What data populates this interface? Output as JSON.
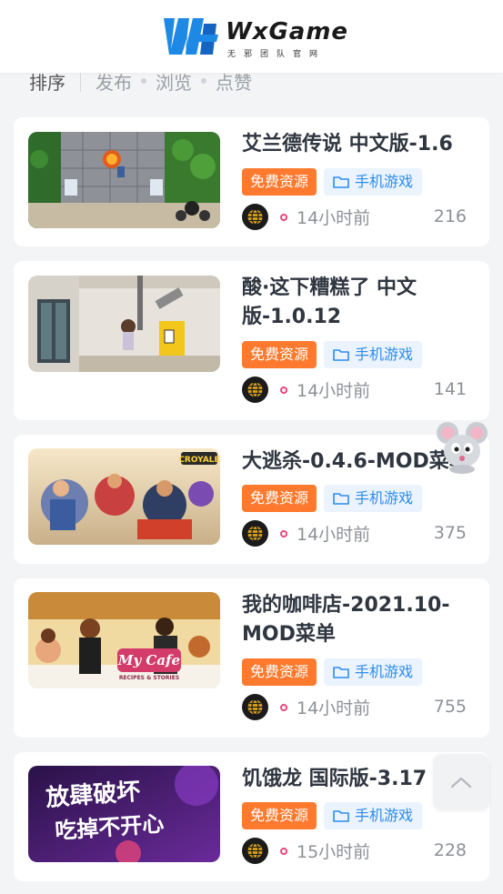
{
  "brand": {
    "name": "WxGame",
    "subtitle": "无邪团队官网"
  },
  "sort": {
    "label": "排序",
    "options": [
      "发布",
      "浏览",
      "点赞"
    ]
  },
  "posts": [
    {
      "title": "艾兰德传说 中文版-1.6",
      "tags": [
        "免费资源",
        "手机游戏"
      ],
      "time": "14小时前",
      "views": "216"
    },
    {
      "title": "酸·这下糟糕了 中文版-1.0.12",
      "tags": [
        "免费资源",
        "手机游戏"
      ],
      "time": "14小时前",
      "views": "141"
    },
    {
      "title": "大逃杀-0.4.6-MOD菜单",
      "tags": [
        "免费资源",
        "手机游戏"
      ],
      "time": "14小时前",
      "views": "375"
    },
    {
      "title": "我的咖啡店-2021.10-MOD菜单",
      "tags": [
        "免费资源",
        "手机游戏"
      ],
      "time": "14小时前",
      "views": "755"
    },
    {
      "title": "饥饿龙 国际版-3.17",
      "tags": [
        "免费资源",
        "手机游戏"
      ],
      "time": "15小时前",
      "views": "228"
    }
  ],
  "thumb_text": {
    "post3_badge": "CROYALE",
    "post4_logo": "My Cafe",
    "post4_sub": "RECIPES & STORIES",
    "post5_line1": "放肆破坏",
    "post5_line2": "吃掉不开心"
  },
  "colors": {
    "free_tag": "#ff7a2e",
    "mobile_tag": "#2e8cf0",
    "accent_dot": "#e8477a"
  },
  "icons": {
    "category": "folder-icon",
    "author": "globe-avatar-icon",
    "back_to_top": "chevron-up-icon",
    "mascot": "mouse-mascot-icon"
  }
}
